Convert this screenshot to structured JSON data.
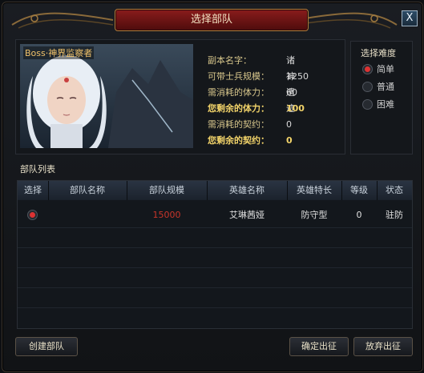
{
  "window": {
    "title": "选择部队",
    "close_label": "X"
  },
  "boss": {
    "label": "Boss·神界监察者"
  },
  "info": [
    {
      "key": "副本名字：",
      "value": "诸神遗迹",
      "bold": false
    },
    {
      "key": "可带士兵规模：",
      "value": "1250",
      "bold": false
    },
    {
      "key": "需消耗的体力：",
      "value": "60",
      "bold": false
    },
    {
      "key": "您剩余的体力：",
      "value": "100",
      "bold": true
    },
    {
      "key": "需消耗的契约：",
      "value": "0",
      "bold": false
    },
    {
      "key": "您剩余的契约：",
      "value": "0",
      "bold": true
    }
  ],
  "difficulty": {
    "title": "选择难度",
    "options": [
      {
        "label": "简单",
        "selected": true
      },
      {
        "label": "普通",
        "selected": false
      },
      {
        "label": "困难",
        "selected": false
      }
    ]
  },
  "list": {
    "title": "部队列表",
    "columns": [
      "选择",
      "部队名称",
      "部队规模",
      "英雄名称",
      "英雄特长",
      "等级",
      "状态"
    ],
    "rows": [
      {
        "selected": true,
        "name": "",
        "size": "15000",
        "hero": "艾琳茜娅",
        "specialty": "防守型",
        "level": "0",
        "status": "驻防"
      }
    ]
  },
  "buttons": {
    "create": "创建部队",
    "confirm": "确定出征",
    "abandon": "放弃出征"
  },
  "colors": {
    "size_value": "#c8352a",
    "title_plate": "#7a1717",
    "gold_text": "#f3d46a"
  }
}
